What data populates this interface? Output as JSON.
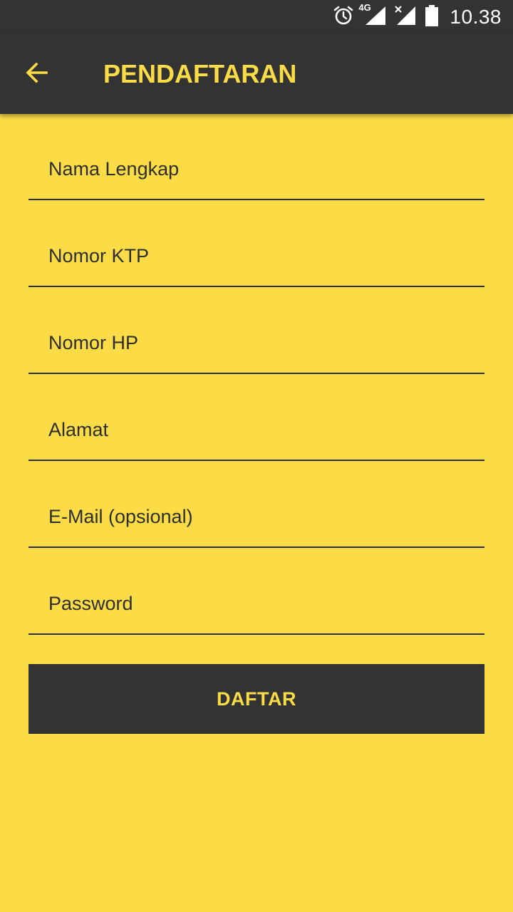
{
  "status_bar": {
    "time": "10.38",
    "network_label": "4G",
    "icons": [
      "alarm-icon",
      "signal-4g-icon",
      "signal-no-service-icon",
      "battery-icon"
    ]
  },
  "app_bar": {
    "title": "PENDAFTARAN",
    "back_icon": "arrow-back-icon",
    "accent_color": "#FBDC47",
    "bar_color": "#333333"
  },
  "form": {
    "fields": [
      {
        "name": "full-name-field",
        "placeholder": "Nama Lengkap",
        "value": ""
      },
      {
        "name": "ktp-number-field",
        "placeholder": "Nomor KTP",
        "value": ""
      },
      {
        "name": "phone-number-field",
        "placeholder": "Nomor HP",
        "value": ""
      },
      {
        "name": "address-field",
        "placeholder": "Alamat",
        "value": ""
      },
      {
        "name": "email-field",
        "placeholder": "E-Mail (opsional)",
        "value": ""
      },
      {
        "name": "password-field",
        "placeholder": "Password",
        "value": ""
      }
    ],
    "submit_label": "DAFTAR"
  },
  "background_color": "#FBDC47"
}
